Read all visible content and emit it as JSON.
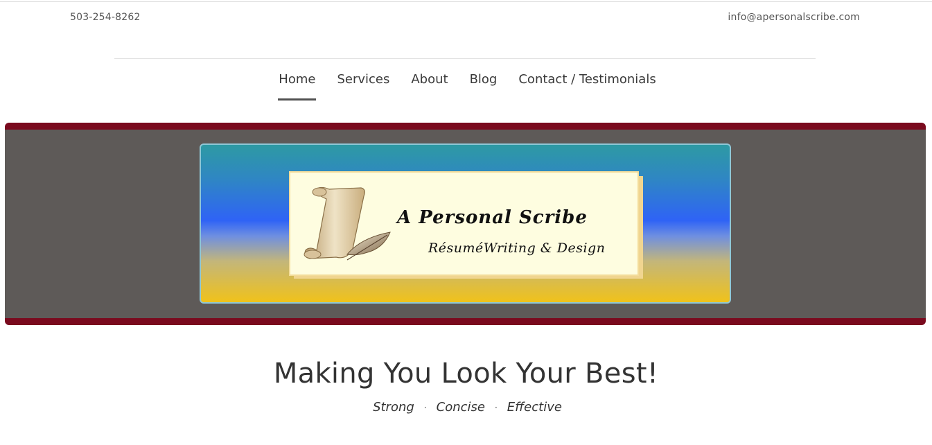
{
  "header": {
    "phone": "503-254-8262",
    "email": "info@apersonalscribe.com"
  },
  "nav": {
    "items": [
      {
        "label": "Home",
        "active": true
      },
      {
        "label": "Services",
        "active": false
      },
      {
        "label": "About",
        "active": false
      },
      {
        "label": "Blog",
        "active": false
      },
      {
        "label": "Contact / Testimonials",
        "active": false
      }
    ]
  },
  "hero": {
    "logo_title": "A Personal Scribe",
    "logo_subtitle": "RésuméWriting & Design",
    "logo_icon": "scroll-quill-icon"
  },
  "main": {
    "headline": "Making You Look Your Best!",
    "tagline": [
      "Strong",
      "Concise",
      "Effective"
    ],
    "separator": "·"
  },
  "colors": {
    "hero_background": "#5e5a58",
    "hero_border": "#7a0a1e",
    "banner_top": "#2e9aa3",
    "banner_middle": "#2f63f6",
    "banner_bottom": "#f0c21a",
    "logo_card": "#fefde0"
  }
}
